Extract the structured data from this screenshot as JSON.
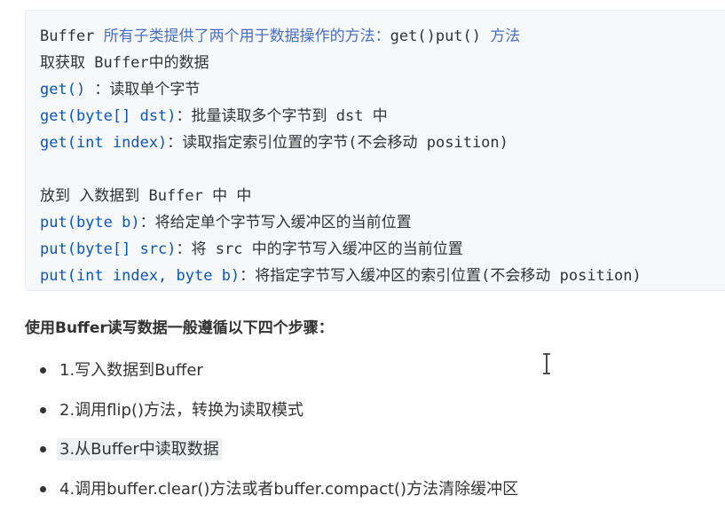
{
  "code_block": {
    "line1": {
      "a": "Buffer ",
      "b": "所有子类提供了两个用于数据操作的方法：",
      "c": "get()put() ",
      "d": "方法"
    },
    "line2": "取获取 Buffer中的数据",
    "line3": {
      "a": "get()",
      "b": " ：读取单个字节"
    },
    "line4": {
      "a": "get(byte[] dst)",
      "b": "：批量读取多个字节到 dst 中"
    },
    "line5": {
      "a": "get(int index)",
      "b": "：读取指定索引位置的字节(不会移动 position)"
    },
    "line6": "放到 入数据到 Buffer 中 中",
    "line7": {
      "a": "put(byte b)",
      "b": "：将给定单个字节写入缓冲区的当前位置"
    },
    "line8": {
      "a": "put(byte[] src)",
      "b": "：将 src 中的字节写入缓冲区的当前位置"
    },
    "line9": {
      "a": "put(int index, byte b)",
      "b": "：将指定字节写入缓冲区的索引位置(不会移动 position)"
    }
  },
  "heading": "使用Buffer读写数据一般遵循以下四个步骤：",
  "steps": [
    "1.写入数据到Buffer",
    "2.调用flip()方法，转换为读取模式",
    "3.从Buffer中读取数据",
    "4.调用buffer.clear()方法或者buffer.compact()方法清除缓冲区"
  ],
  "colors": {
    "keyword": "#0b57b8",
    "comment": "#4a6fc2",
    "code_bg": "#f6f8fa",
    "text": "#333333"
  },
  "icons": {
    "cursor": "text-cursor-icon"
  }
}
